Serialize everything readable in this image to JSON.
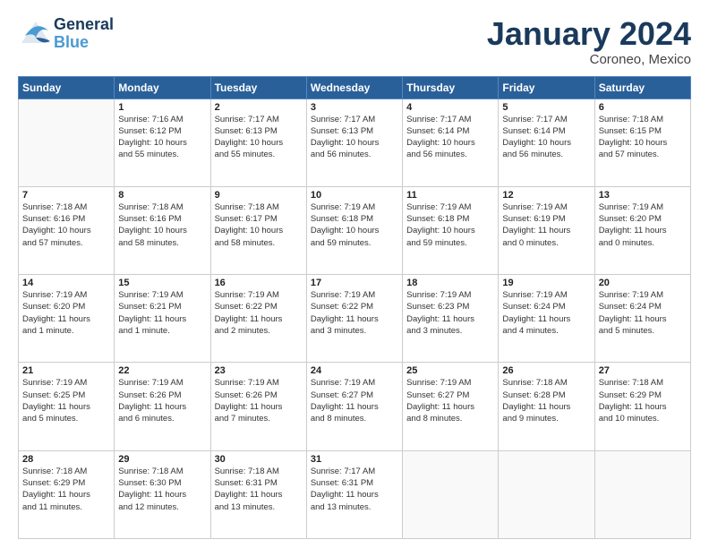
{
  "header": {
    "logo_general": "General",
    "logo_blue": "Blue",
    "month_title": "January 2024",
    "location": "Coroneo, Mexico"
  },
  "weekdays": [
    "Sunday",
    "Monday",
    "Tuesday",
    "Wednesday",
    "Thursday",
    "Friday",
    "Saturday"
  ],
  "weeks": [
    [
      {
        "day": "",
        "info": ""
      },
      {
        "day": "1",
        "info": "Sunrise: 7:16 AM\nSunset: 6:12 PM\nDaylight: 10 hours\nand 55 minutes."
      },
      {
        "day": "2",
        "info": "Sunrise: 7:17 AM\nSunset: 6:13 PM\nDaylight: 10 hours\nand 55 minutes."
      },
      {
        "day": "3",
        "info": "Sunrise: 7:17 AM\nSunset: 6:13 PM\nDaylight: 10 hours\nand 56 minutes."
      },
      {
        "day": "4",
        "info": "Sunrise: 7:17 AM\nSunset: 6:14 PM\nDaylight: 10 hours\nand 56 minutes."
      },
      {
        "day": "5",
        "info": "Sunrise: 7:17 AM\nSunset: 6:14 PM\nDaylight: 10 hours\nand 56 minutes."
      },
      {
        "day": "6",
        "info": "Sunrise: 7:18 AM\nSunset: 6:15 PM\nDaylight: 10 hours\nand 57 minutes."
      }
    ],
    [
      {
        "day": "7",
        "info": "Sunrise: 7:18 AM\nSunset: 6:16 PM\nDaylight: 10 hours\nand 57 minutes."
      },
      {
        "day": "8",
        "info": "Sunrise: 7:18 AM\nSunset: 6:16 PM\nDaylight: 10 hours\nand 58 minutes."
      },
      {
        "day": "9",
        "info": "Sunrise: 7:18 AM\nSunset: 6:17 PM\nDaylight: 10 hours\nand 58 minutes."
      },
      {
        "day": "10",
        "info": "Sunrise: 7:19 AM\nSunset: 6:18 PM\nDaylight: 10 hours\nand 59 minutes."
      },
      {
        "day": "11",
        "info": "Sunrise: 7:19 AM\nSunset: 6:18 PM\nDaylight: 10 hours\nand 59 minutes."
      },
      {
        "day": "12",
        "info": "Sunrise: 7:19 AM\nSunset: 6:19 PM\nDaylight: 11 hours\nand 0 minutes."
      },
      {
        "day": "13",
        "info": "Sunrise: 7:19 AM\nSunset: 6:20 PM\nDaylight: 11 hours\nand 0 minutes."
      }
    ],
    [
      {
        "day": "14",
        "info": "Sunrise: 7:19 AM\nSunset: 6:20 PM\nDaylight: 11 hours\nand 1 minute."
      },
      {
        "day": "15",
        "info": "Sunrise: 7:19 AM\nSunset: 6:21 PM\nDaylight: 11 hours\nand 1 minute."
      },
      {
        "day": "16",
        "info": "Sunrise: 7:19 AM\nSunset: 6:22 PM\nDaylight: 11 hours\nand 2 minutes."
      },
      {
        "day": "17",
        "info": "Sunrise: 7:19 AM\nSunset: 6:22 PM\nDaylight: 11 hours\nand 3 minutes."
      },
      {
        "day": "18",
        "info": "Sunrise: 7:19 AM\nSunset: 6:23 PM\nDaylight: 11 hours\nand 3 minutes."
      },
      {
        "day": "19",
        "info": "Sunrise: 7:19 AM\nSunset: 6:24 PM\nDaylight: 11 hours\nand 4 minutes."
      },
      {
        "day": "20",
        "info": "Sunrise: 7:19 AM\nSunset: 6:24 PM\nDaylight: 11 hours\nand 5 minutes."
      }
    ],
    [
      {
        "day": "21",
        "info": "Sunrise: 7:19 AM\nSunset: 6:25 PM\nDaylight: 11 hours\nand 5 minutes."
      },
      {
        "day": "22",
        "info": "Sunrise: 7:19 AM\nSunset: 6:26 PM\nDaylight: 11 hours\nand 6 minutes."
      },
      {
        "day": "23",
        "info": "Sunrise: 7:19 AM\nSunset: 6:26 PM\nDaylight: 11 hours\nand 7 minutes."
      },
      {
        "day": "24",
        "info": "Sunrise: 7:19 AM\nSunset: 6:27 PM\nDaylight: 11 hours\nand 8 minutes."
      },
      {
        "day": "25",
        "info": "Sunrise: 7:19 AM\nSunset: 6:27 PM\nDaylight: 11 hours\nand 8 minutes."
      },
      {
        "day": "26",
        "info": "Sunrise: 7:18 AM\nSunset: 6:28 PM\nDaylight: 11 hours\nand 9 minutes."
      },
      {
        "day": "27",
        "info": "Sunrise: 7:18 AM\nSunset: 6:29 PM\nDaylight: 11 hours\nand 10 minutes."
      }
    ],
    [
      {
        "day": "28",
        "info": "Sunrise: 7:18 AM\nSunset: 6:29 PM\nDaylight: 11 hours\nand 11 minutes."
      },
      {
        "day": "29",
        "info": "Sunrise: 7:18 AM\nSunset: 6:30 PM\nDaylight: 11 hours\nand 12 minutes."
      },
      {
        "day": "30",
        "info": "Sunrise: 7:18 AM\nSunset: 6:31 PM\nDaylight: 11 hours\nand 13 minutes."
      },
      {
        "day": "31",
        "info": "Sunrise: 7:17 AM\nSunset: 6:31 PM\nDaylight: 11 hours\nand 13 minutes."
      },
      {
        "day": "",
        "info": ""
      },
      {
        "day": "",
        "info": ""
      },
      {
        "day": "",
        "info": ""
      }
    ]
  ]
}
